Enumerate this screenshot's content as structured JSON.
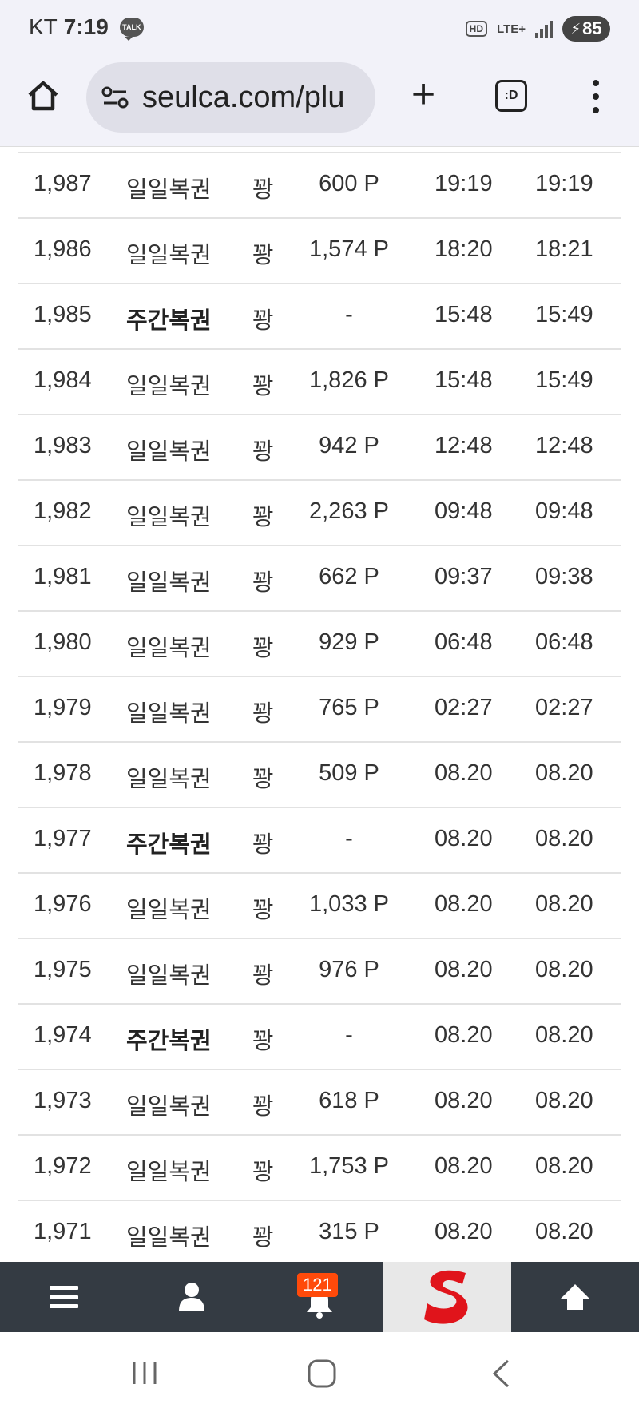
{
  "status_bar": {
    "carrier": "KT",
    "time": "7:19",
    "talk_label": "TALK",
    "hd_label": "HD",
    "network": "LTE+",
    "battery": "85"
  },
  "browser": {
    "url": "seulca.com/plu",
    "tabs_label": ":D"
  },
  "rows": [
    {
      "no": "1,987",
      "title": "일일복권",
      "bold": false,
      "emo": "꽝",
      "points": "600 P",
      "t1": "19:19",
      "t2": "19:19"
    },
    {
      "no": "1,986",
      "title": "일일복권",
      "bold": false,
      "emo": "꽝",
      "points": "1,574 P",
      "t1": "18:20",
      "t2": "18:21"
    },
    {
      "no": "1,985",
      "title": "주간복권",
      "bold": true,
      "emo": "꽝",
      "points": "-",
      "t1": "15:48",
      "t2": "15:49"
    },
    {
      "no": "1,984",
      "title": "일일복권",
      "bold": false,
      "emo": "꽝",
      "points": "1,826 P",
      "t1": "15:48",
      "t2": "15:49"
    },
    {
      "no": "1,983",
      "title": "일일복권",
      "bold": false,
      "emo": "꽝",
      "points": "942 P",
      "t1": "12:48",
      "t2": "12:48"
    },
    {
      "no": "1,982",
      "title": "일일복권",
      "bold": false,
      "emo": "꽝",
      "points": "2,263 P",
      "t1": "09:48",
      "t2": "09:48"
    },
    {
      "no": "1,981",
      "title": "일일복권",
      "bold": false,
      "emo": "꽝",
      "points": "662 P",
      "t1": "09:37",
      "t2": "09:38"
    },
    {
      "no": "1,980",
      "title": "일일복권",
      "bold": false,
      "emo": "꽝",
      "points": "929 P",
      "t1": "06:48",
      "t2": "06:48"
    },
    {
      "no": "1,979",
      "title": "일일복권",
      "bold": false,
      "emo": "꽝",
      "points": "765 P",
      "t1": "02:27",
      "t2": "02:27"
    },
    {
      "no": "1,978",
      "title": "일일복권",
      "bold": false,
      "emo": "꽝",
      "points": "509 P",
      "t1": "08.20",
      "t2": "08.20"
    },
    {
      "no": "1,977",
      "title": "주간복권",
      "bold": true,
      "emo": "꽝",
      "points": "-",
      "t1": "08.20",
      "t2": "08.20"
    },
    {
      "no": "1,976",
      "title": "일일복권",
      "bold": false,
      "emo": "꽝",
      "points": "1,033 P",
      "t1": "08.20",
      "t2": "08.20"
    },
    {
      "no": "1,975",
      "title": "일일복권",
      "bold": false,
      "emo": "꽝",
      "points": "976 P",
      "t1": "08.20",
      "t2": "08.20"
    },
    {
      "no": "1,974",
      "title": "주간복권",
      "bold": true,
      "emo": "꽝",
      "points": "-",
      "t1": "08.20",
      "t2": "08.20"
    },
    {
      "no": "1,973",
      "title": "일일복권",
      "bold": false,
      "emo": "꽝",
      "points": "618 P",
      "t1": "08.20",
      "t2": "08.20"
    },
    {
      "no": "1,972",
      "title": "일일복권",
      "bold": false,
      "emo": "꽝",
      "points": "1,753 P",
      "t1": "08.20",
      "t2": "08.20"
    },
    {
      "no": "1,971",
      "title": "일일복권",
      "bold": false,
      "emo": "꽝",
      "points": "315 P",
      "t1": "08.20",
      "t2": "08.20"
    }
  ],
  "bottom_nav": {
    "notification_count": "121",
    "icons": [
      "menu-icon",
      "user-icon",
      "bell-icon",
      "site-logo",
      "arrow-up-icon"
    ]
  },
  "colors": {
    "nav_bg": "#343b43",
    "badge": "#ff4a0a",
    "logo_red": "#e0141b"
  }
}
